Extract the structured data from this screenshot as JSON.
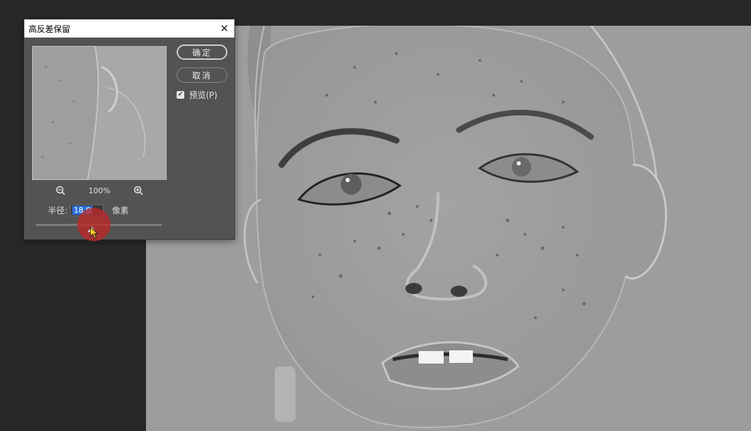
{
  "dialog": {
    "title": "高反差保留",
    "close_glyph": "✕",
    "zoom_level": "100%",
    "radius_label": "半径:",
    "radius_value": "18.0",
    "unit_label": "像素",
    "preview_checked": true,
    "preview_label": "预览(P)",
    "radius_slider_fraction": 0.44
  },
  "buttons": {
    "ok_label": "确定",
    "cancel_label": "取消"
  },
  "icons": {
    "zoom_out": "zoom-out-icon",
    "zoom_in": "zoom-in-icon",
    "check": "check-icon",
    "cursor": "pointer-cursor"
  },
  "colors": {
    "click_highlight": "#be2828",
    "cursor_fill": "#ffd21e",
    "selection": "#2c6fd9"
  }
}
